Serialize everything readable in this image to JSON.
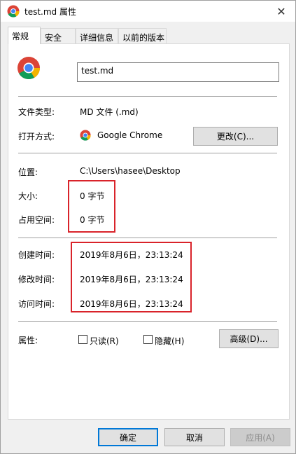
{
  "window": {
    "title": "test.md 属性",
    "close_glyph": "✕"
  },
  "tabs": [
    {
      "label": "常规",
      "active": true
    },
    {
      "label": "安全",
      "active": false
    },
    {
      "label": "详细信息",
      "active": false
    },
    {
      "label": "以前的版本",
      "active": false
    }
  ],
  "general": {
    "file_name": "test.md",
    "file_type_label": "文件类型:",
    "file_type_value": "MD 文件 (.md)",
    "opens_with_label": "打开方式:",
    "opens_with_value": "Google Chrome",
    "change_button": "更改(C)...",
    "location_label": "位置:",
    "location_value": "C:\\Users\\hasee\\Desktop",
    "size_label": "大小:",
    "size_value": "0 字节",
    "size_on_disk_label": "占用空间:",
    "size_on_disk_value": "0 字节",
    "created_label": "创建时间:",
    "created_value": "2019年8月6日，23:13:24",
    "modified_label": "修改时间:",
    "modified_value": "2019年8月6日，23:13:24",
    "accessed_label": "访问时间:",
    "accessed_value": "2019年8月6日，23:13:24",
    "attributes_label": "属性:",
    "readonly_label": "只读(R)",
    "hidden_label": "隐藏(H)",
    "advanced_button": "高级(D)..."
  },
  "footer": {
    "ok_button": "确定",
    "cancel_button": "取消",
    "apply_button": "应用(A)"
  },
  "colors": {
    "highlight_box": "#d9232a",
    "primary_border": "#0078d7"
  },
  "icons": {
    "app": "chrome-icon"
  }
}
